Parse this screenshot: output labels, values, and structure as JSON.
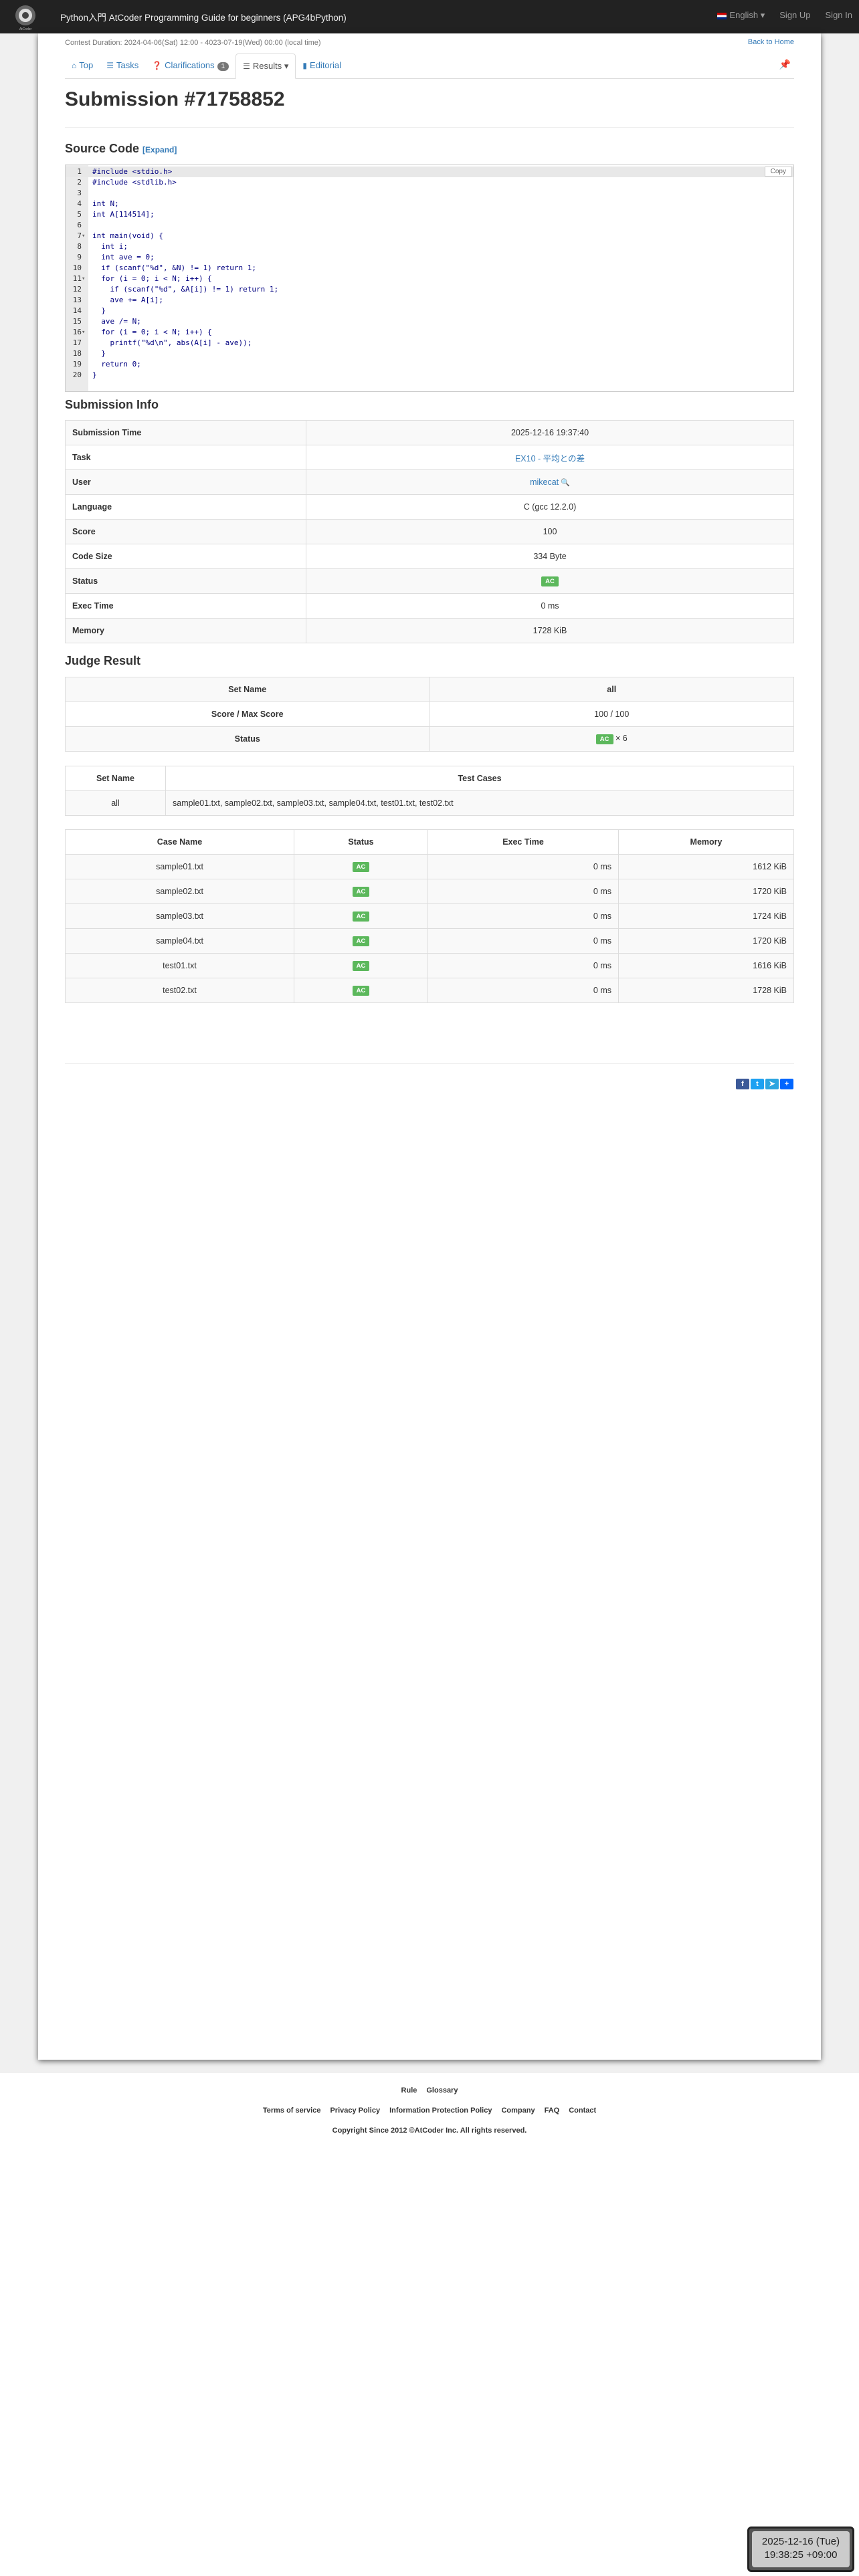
{
  "navbar": {
    "logo_text": "AtCoder",
    "title": "Python入門 AtCoder Programming Guide for beginners (APG4bPython)",
    "language": "English",
    "sign_up": "Sign Up",
    "sign_in": "Sign In"
  },
  "contest": {
    "duration": "Contest Duration: 2024-04-06(Sat) 12:00 - 4023-07-19(Wed) 00:00 (local time)",
    "back_home": "Back to Home"
  },
  "tabs": [
    {
      "icon": "home-icon",
      "label": "Top"
    },
    {
      "icon": "list-icon",
      "label": "Tasks"
    },
    {
      "icon": "question-icon",
      "label": "Clarifications",
      "badge": "1"
    },
    {
      "icon": "list-icon",
      "label": "Results"
    },
    {
      "icon": "book-icon",
      "label": "Editorial"
    }
  ],
  "page": {
    "title": "Submission #71758852",
    "source_code_heading": "Source Code",
    "expand_label": "[Expand]",
    "copy_label": "Copy",
    "submission_info_heading": "Submission Info",
    "judge_result_heading": "Judge Result"
  },
  "code_lines": [
    "#include <stdio.h>",
    "#include <stdlib.h>",
    "",
    "int N;",
    "int A[114514];",
    "",
    "int main(void) {",
    "  int i;",
    "  int ave = 0;",
    "  if (scanf(\"%d\", &N) != 1) return 1;",
    "  for (i = 0; i < N; i++) {",
    "    if (scanf(\"%d\", &A[i]) != 1) return 1;",
    "    ave += A[i];",
    "  }",
    "  ave /= N;",
    "  for (i = 0; i < N; i++) {",
    "    printf(\"%d\\n\", abs(A[i] - ave));",
    "  }",
    "  return 0;",
    "}"
  ],
  "submission_info": {
    "rows": [
      {
        "label": "Submission Time",
        "value": "2025-12-16 19:37:40"
      },
      {
        "label": "Task",
        "value": "EX10 - 平均との差"
      },
      {
        "label": "User",
        "value": "mikecat"
      },
      {
        "label": "Language",
        "value": "C (gcc 12.2.0)"
      },
      {
        "label": "Score",
        "value": "100"
      },
      {
        "label": "Code Size",
        "value": "334 Byte"
      },
      {
        "label": "Status",
        "value": "AC"
      },
      {
        "label": "Exec Time",
        "value": "0 ms"
      },
      {
        "label": "Memory",
        "value": "1728 KiB"
      }
    ]
  },
  "judge_summary": {
    "set_name_label": "Set Name",
    "set_name": "all",
    "score_label": "Score / Max Score",
    "score": "100 / 100",
    "status_label": "Status",
    "status": "AC",
    "status_count": "× 6"
  },
  "sets_table": {
    "headers": [
      "Set Name",
      "Test Cases"
    ],
    "rows": [
      {
        "name": "all",
        "cases": "sample01.txt, sample02.txt, sample03.txt, sample04.txt, test01.txt, test02.txt"
      }
    ]
  },
  "cases_table": {
    "headers": [
      "Case Name",
      "Status",
      "Exec Time",
      "Memory"
    ],
    "rows": [
      {
        "name": "sample01.txt",
        "status": "AC",
        "time": "0 ms",
        "memory": "1612 KiB"
      },
      {
        "name": "sample02.txt",
        "status": "AC",
        "time": "0 ms",
        "memory": "1720 KiB"
      },
      {
        "name": "sample03.txt",
        "status": "AC",
        "time": "0 ms",
        "memory": "1724 KiB"
      },
      {
        "name": "sample04.txt",
        "status": "AC",
        "time": "0 ms",
        "memory": "1720 KiB"
      },
      {
        "name": "test01.txt",
        "status": "AC",
        "time": "0 ms",
        "memory": "1616 KiB"
      },
      {
        "name": "test02.txt",
        "status": "AC",
        "time": "0 ms",
        "memory": "1728 KiB"
      }
    ]
  },
  "share_icons": [
    "facebook-icon",
    "twitter-icon",
    "telegram-icon",
    "share-plus-icon"
  ],
  "footer": {
    "row1": [
      "Rule",
      "Glossary"
    ],
    "row2": [
      "Terms of service",
      "Privacy Policy",
      "Information Protection Policy",
      "Company",
      "FAQ",
      "Contact"
    ],
    "copyright": "Copyright Since 2012 ©AtCoder Inc. All rights reserved."
  },
  "clock": {
    "date": "2025-12-16 (Tue)",
    "time": "19:38:25 +09:00"
  },
  "colors": {
    "navbar": "#222222",
    "link": "#337ab7",
    "success": "#5cb85c"
  }
}
